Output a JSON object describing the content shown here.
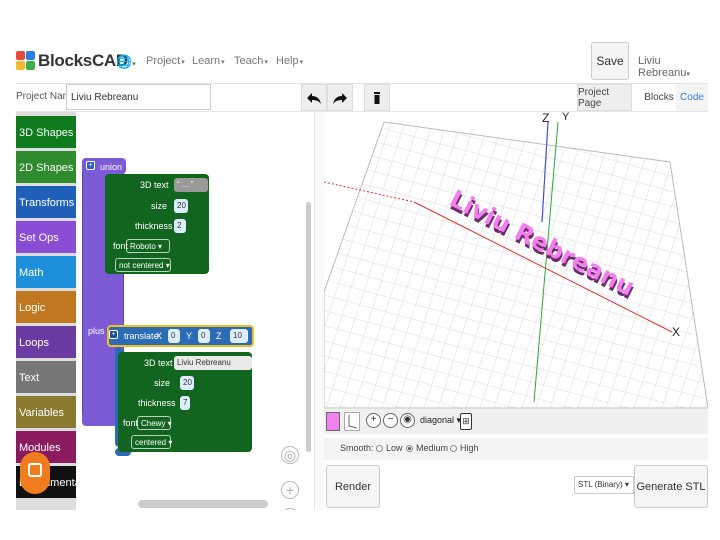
{
  "nav": {
    "brand": "BlocksCAD",
    "menus": [
      "Project",
      "Learn",
      "Teach",
      "Help"
    ],
    "save_label": "Save",
    "user_name": "Liviu Rebreanu"
  },
  "project": {
    "name_label": "Project Name",
    "name_value": "Liviu Rebreanu"
  },
  "toolbar": {
    "undo_icon": "undo-arrow-icon",
    "redo_icon": "redo-arrow-icon",
    "trash_icon": "trash-icon",
    "project_page_label": "Project Page",
    "blocks_tab_label": "Blocks",
    "code_tab_label": "Code"
  },
  "toolbox": {
    "categories": [
      {
        "label": "3D Shapes",
        "color": "#0f7a1e"
      },
      {
        "label": "2D Shapes",
        "color": "#2e8b2e"
      },
      {
        "label": "Transforms",
        "color": "#2160b8"
      },
      {
        "label": "Set Ops",
        "color": "#8a4dd6"
      },
      {
        "label": "Math",
        "color": "#1e8fdb"
      },
      {
        "label": "Logic",
        "color": "#c07820"
      },
      {
        "label": "Loops",
        "color": "#6a3ba0"
      },
      {
        "label": "Text",
        "color": "#777777"
      },
      {
        "label": "Variables",
        "color": "#8a7a30"
      },
      {
        "label": "Modules",
        "color": "#8b1a5e"
      },
      {
        "label": "Experimental",
        "color": "#111111"
      }
    ]
  },
  "blocks": {
    "union_label": "union",
    "plus_label": "plus",
    "text3d_1": {
      "label": "3D text",
      "value": "“ ... ”",
      "size_label": "size",
      "size_value": "20",
      "thickness_label": "thickness",
      "thickness_value": "2",
      "font_label": "font",
      "font_value": "Roboto",
      "align_value": "not centered"
    },
    "translate": {
      "label": "translate",
      "x_label": "X",
      "x_value": "0",
      "y_label": "Y",
      "y_value": "0",
      "z_label": "Z",
      "z_value": "10"
    },
    "text3d_2": {
      "label": "3D text",
      "value": "Liviu Rebreanu",
      "size_label": "size",
      "size_value": "20",
      "thickness_label": "thickness",
      "thickness_value": "7",
      "font_label": "font",
      "font_value": "Chewy",
      "align_value": "centered"
    }
  },
  "viewer": {
    "axis_x": "X",
    "axis_y": "Y",
    "axis_z": "Z",
    "model_text": "Liviu Rebreanu",
    "model_color": "#f47ef0",
    "view_mode": "diagonal",
    "smooth_label": "Smooth:",
    "smooth_options": [
      "Low",
      "Medium",
      "High"
    ],
    "smooth_selected": "Medium"
  },
  "actions": {
    "render_label": "Render",
    "export_format": "STL (Binary)",
    "generate_label": "Generate STL"
  }
}
